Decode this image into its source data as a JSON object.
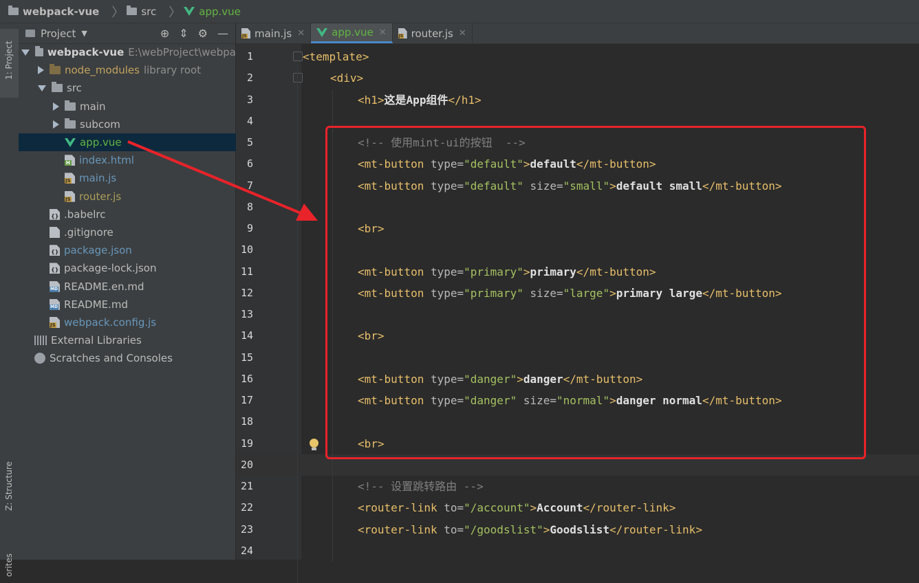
{
  "breadcrumb": [
    "webpack-vue",
    "src",
    "app.vue"
  ],
  "toolwindows": {
    "project": "1: Project",
    "structure": "Z: Structure",
    "favorites": "orites"
  },
  "project_panel": {
    "title": "Project",
    "tools": [
      "locate-icon",
      "collapse-icon",
      "gear-icon",
      "hide-icon"
    ],
    "tree": [
      {
        "label": "webpack-vue",
        "hint": "E:\\webProject\\webpa",
        "icon": "folder",
        "arrow": "down",
        "indent": 0,
        "style": "bold"
      },
      {
        "label": "node_modules",
        "hint": "library root",
        "icon": "folder-excluded",
        "arrow": "right",
        "indent": 1,
        "style": "excl"
      },
      {
        "label": "src",
        "hint": "",
        "icon": "folder",
        "arrow": "down",
        "indent": 1,
        "style": ""
      },
      {
        "label": "main",
        "hint": "",
        "icon": "folder",
        "arrow": "right",
        "indent": 2,
        "style": ""
      },
      {
        "label": "subcom",
        "hint": "",
        "icon": "folder",
        "arrow": "right",
        "indent": 2,
        "style": ""
      },
      {
        "label": "app.vue",
        "hint": "",
        "icon": "vue",
        "arrow": "",
        "indent": 2,
        "style": "green",
        "selected": true
      },
      {
        "label": "index.html",
        "hint": "",
        "icon": "html",
        "arrow": "",
        "indent": 2,
        "style": "blue"
      },
      {
        "label": "main.js",
        "hint": "",
        "icon": "js",
        "arrow": "",
        "indent": 2,
        "style": "blue"
      },
      {
        "label": "router.js",
        "hint": "",
        "icon": "js",
        "arrow": "",
        "indent": 2,
        "style": "olive"
      },
      {
        "label": ".babelrc",
        "hint": "",
        "icon": "cfg",
        "arrow": "",
        "indent": 1,
        "style": ""
      },
      {
        "label": ".gitignore",
        "hint": "",
        "icon": "file",
        "arrow": "",
        "indent": 1,
        "style": ""
      },
      {
        "label": "package.json",
        "hint": "",
        "icon": "cfg",
        "arrow": "",
        "indent": 1,
        "style": "blue"
      },
      {
        "label": "package-lock.json",
        "hint": "",
        "icon": "cfg",
        "arrow": "",
        "indent": 1,
        "style": ""
      },
      {
        "label": "README.en.md",
        "hint": "",
        "icon": "md",
        "arrow": "",
        "indent": 1,
        "style": ""
      },
      {
        "label": "README.md",
        "hint": "",
        "icon": "md",
        "arrow": "",
        "indent": 1,
        "style": ""
      },
      {
        "label": "webpack.config.js",
        "hint": "",
        "icon": "js",
        "arrow": "",
        "indent": 1,
        "style": "blue"
      },
      {
        "label": "External Libraries",
        "hint": "",
        "icon": "lib",
        "arrow": "",
        "indent": 0,
        "style": ""
      },
      {
        "label": "Scratches and Consoles",
        "hint": "",
        "icon": "scratch",
        "arrow": "",
        "indent": 0,
        "style": ""
      }
    ]
  },
  "tabs": [
    {
      "label": "main.js",
      "icon": "js",
      "active": false
    },
    {
      "label": "app.vue",
      "icon": "vue",
      "active": true
    },
    {
      "label": "router.js",
      "icon": "js",
      "active": false
    }
  ],
  "editor": {
    "current_line": 20,
    "lines": [
      {
        "n": "1",
        "indent": 0,
        "tokens": [
          [
            "br",
            "<"
          ],
          [
            "tag",
            "template"
          ],
          [
            "br",
            ">"
          ]
        ]
      },
      {
        "n": "2",
        "indent": 1,
        "tokens": [
          [
            "br",
            "<"
          ],
          [
            "tag",
            "div"
          ],
          [
            "br",
            ">"
          ]
        ]
      },
      {
        "n": "3",
        "indent": 2,
        "tokens": [
          [
            "br",
            "<"
          ],
          [
            "tag",
            "h1"
          ],
          [
            "br",
            ">"
          ],
          [
            "txt",
            "这是App组件"
          ],
          [
            "br",
            "</"
          ],
          [
            "tag",
            "h1"
          ],
          [
            "br",
            ">"
          ]
        ]
      },
      {
        "n": "4",
        "indent": 2,
        "tokens": []
      },
      {
        "n": "5",
        "indent": 2,
        "tokens": [
          [
            "com",
            "<!-- 使用mint-ui的按钮  -->"
          ]
        ]
      },
      {
        "n": "6",
        "indent": 2,
        "tokens": [
          [
            "br",
            "<"
          ],
          [
            "tag",
            "mt-button"
          ],
          [
            "attr",
            " type="
          ],
          [
            "val",
            "\"default\""
          ],
          [
            "br",
            ">"
          ],
          [
            "txt",
            "default"
          ],
          [
            "br",
            "</"
          ],
          [
            "tag",
            "mt-button"
          ],
          [
            "br",
            ">"
          ]
        ]
      },
      {
        "n": "7",
        "indent": 2,
        "tokens": [
          [
            "br",
            "<"
          ],
          [
            "tag",
            "mt-button"
          ],
          [
            "attr",
            " type="
          ],
          [
            "val",
            "\"default\""
          ],
          [
            "attr",
            " size="
          ],
          [
            "val",
            "\"small\""
          ],
          [
            "br",
            ">"
          ],
          [
            "txt",
            "default small"
          ],
          [
            "br",
            "</"
          ],
          [
            "tag",
            "mt-button"
          ],
          [
            "br",
            ">"
          ]
        ]
      },
      {
        "n": "8",
        "indent": 2,
        "tokens": []
      },
      {
        "n": "9",
        "indent": 2,
        "tokens": [
          [
            "br",
            "<"
          ],
          [
            "tag",
            "br"
          ],
          [
            "br",
            ">"
          ]
        ]
      },
      {
        "n": "10",
        "indent": 2,
        "tokens": []
      },
      {
        "n": "11",
        "indent": 2,
        "tokens": [
          [
            "br",
            "<"
          ],
          [
            "tag",
            "mt-button"
          ],
          [
            "attr",
            " type="
          ],
          [
            "val",
            "\"primary\""
          ],
          [
            "br",
            ">"
          ],
          [
            "txt",
            "primary"
          ],
          [
            "br",
            "</"
          ],
          [
            "tag",
            "mt-button"
          ],
          [
            "br",
            ">"
          ]
        ]
      },
      {
        "n": "12",
        "indent": 2,
        "tokens": [
          [
            "br",
            "<"
          ],
          [
            "tag",
            "mt-button"
          ],
          [
            "attr",
            " type="
          ],
          [
            "val",
            "\"primary\""
          ],
          [
            "attr",
            " size="
          ],
          [
            "val",
            "\"large\""
          ],
          [
            "br",
            ">"
          ],
          [
            "txt",
            "primary large"
          ],
          [
            "br",
            "</"
          ],
          [
            "tag",
            "mt-button"
          ],
          [
            "br",
            ">"
          ]
        ]
      },
      {
        "n": "13",
        "indent": 2,
        "tokens": []
      },
      {
        "n": "14",
        "indent": 2,
        "tokens": [
          [
            "br",
            "<"
          ],
          [
            "tag",
            "br"
          ],
          [
            "br",
            ">"
          ]
        ]
      },
      {
        "n": "15",
        "indent": 2,
        "tokens": []
      },
      {
        "n": "16",
        "indent": 2,
        "tokens": [
          [
            "br",
            "<"
          ],
          [
            "tag",
            "mt-button"
          ],
          [
            "attr",
            " type="
          ],
          [
            "val",
            "\"danger\""
          ],
          [
            "br",
            ">"
          ],
          [
            "txt",
            "danger"
          ],
          [
            "br",
            "</"
          ],
          [
            "tag",
            "mt-button"
          ],
          [
            "br",
            ">"
          ]
        ]
      },
      {
        "n": "17",
        "indent": 2,
        "tokens": [
          [
            "br",
            "<"
          ],
          [
            "tag",
            "mt-button"
          ],
          [
            "attr",
            " type="
          ],
          [
            "val",
            "\"danger\""
          ],
          [
            "attr",
            " size="
          ],
          [
            "val",
            "\"normal\""
          ],
          [
            "br",
            ">"
          ],
          [
            "txt",
            "danger normal"
          ],
          [
            "br",
            "</"
          ],
          [
            "tag",
            "mt-button"
          ],
          [
            "br",
            ">"
          ]
        ]
      },
      {
        "n": "18",
        "indent": 2,
        "tokens": []
      },
      {
        "n": "19",
        "indent": 2,
        "tokens": [
          [
            "br",
            "<"
          ],
          [
            "tag",
            "br"
          ],
          [
            "br",
            ">"
          ]
        ]
      },
      {
        "n": "20",
        "indent": 2,
        "tokens": []
      },
      {
        "n": "21",
        "indent": 2,
        "tokens": [
          [
            "com",
            "<!-- 设置跳转路由 -->"
          ]
        ]
      },
      {
        "n": "22",
        "indent": 2,
        "tokens": [
          [
            "br",
            "<"
          ],
          [
            "tag",
            "router-link"
          ],
          [
            "attr",
            " to="
          ],
          [
            "val",
            "\"/account\""
          ],
          [
            "br",
            ">"
          ],
          [
            "txt",
            "Account"
          ],
          [
            "br",
            "</"
          ],
          [
            "tag",
            "router-link"
          ],
          [
            "br",
            ">"
          ]
        ]
      },
      {
        "n": "23",
        "indent": 2,
        "tokens": [
          [
            "br",
            "<"
          ],
          [
            "tag",
            "router-link"
          ],
          [
            "attr",
            " to="
          ],
          [
            "val",
            "\"/goodslist\""
          ],
          [
            "br",
            ">"
          ],
          [
            "txt",
            "Goodslist"
          ],
          [
            "br",
            "</"
          ],
          [
            "tag",
            "router-link"
          ],
          [
            "br",
            ">"
          ]
        ]
      },
      {
        "n": "24",
        "indent": 2,
        "tokens": []
      }
    ]
  },
  "colors": {
    "tag": "#e8bf6a",
    "attr": "#bababa",
    "value": "#a5c261",
    "comment": "#808080",
    "highlight_box": "#e8232a",
    "selection": "#0d293e"
  }
}
